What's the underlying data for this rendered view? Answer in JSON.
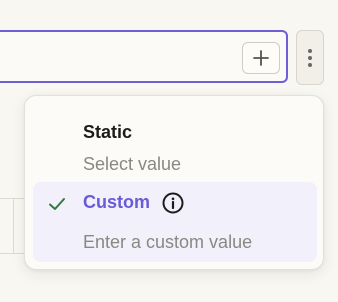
{
  "field": {
    "add_icon": "plus-icon",
    "more_icon": "kebab-vertical-icon"
  },
  "menu": {
    "options": [
      {
        "label": "Static",
        "description": "Select value",
        "selected": false
      },
      {
        "label": "Custom",
        "description": "Enter a custom value",
        "selected": true,
        "icons": [
          "check-icon",
          "info-icon"
        ]
      }
    ]
  },
  "colors": {
    "accent": "#6a5ad8",
    "focus_border": "#6f5fd6",
    "check": "#2f7a3a",
    "selected_bg": "#f1f0fb",
    "muted_text": "#8a8882",
    "background": "#f8f7f2"
  }
}
